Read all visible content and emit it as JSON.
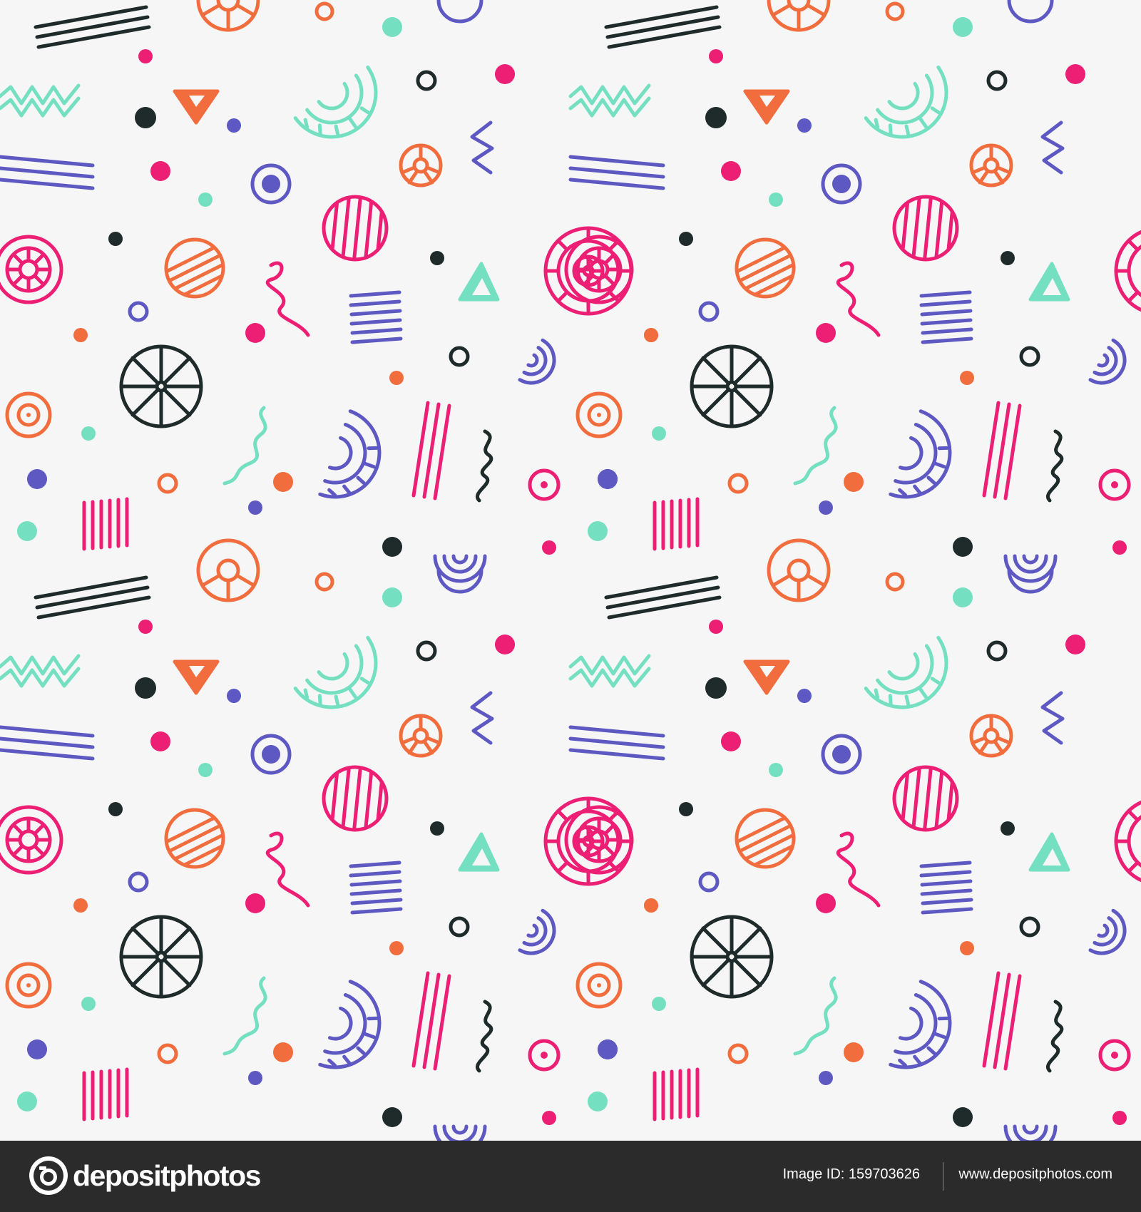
{
  "footer": {
    "brand_name": "depositphotos",
    "image_id": "Image ID: 159703626",
    "website": "www.depositphotos.com"
  },
  "palette": {
    "background": "#f6f6f6",
    "pink": "#ec1f74",
    "orange": "#f26d3d",
    "mint": "#74e0c1",
    "purple": "#5e58c3",
    "dark": "#1f2a2a",
    "footer_bg": "#2b2b2b"
  },
  "pattern": {
    "description_icons": [
      "striped-circle-icon",
      "wheel-icon",
      "gear-arc-icon",
      "zigzag-icon",
      "triangle-icon",
      "ring-icon",
      "squiggle-icon",
      "stripe-lines-icon",
      "dot-icon"
    ]
  }
}
